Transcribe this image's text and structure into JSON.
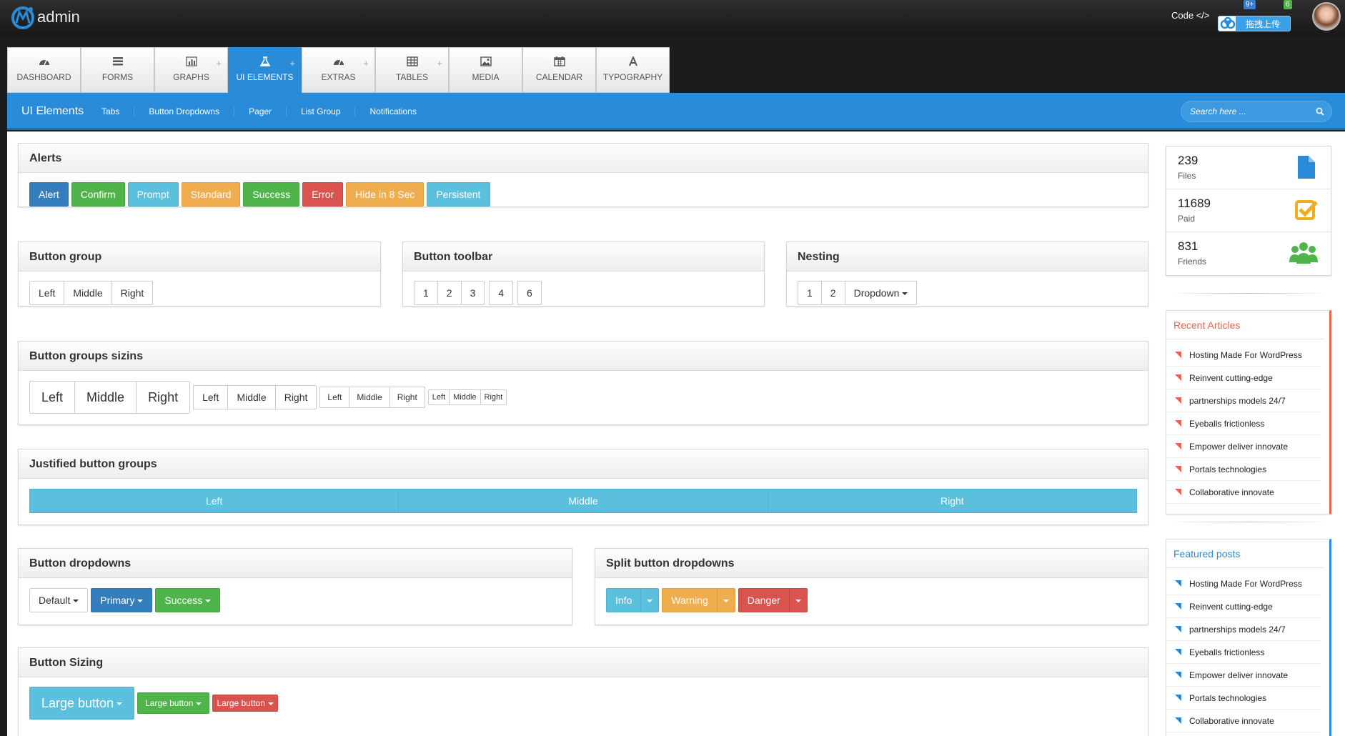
{
  "topbar": {
    "brand": "admin",
    "code_label": "Code </>",
    "badge_messages": "9+",
    "badge_alerts": "6",
    "upload_label": "拖拽上传"
  },
  "tabs": [
    {
      "label": "DASHBOARD",
      "icon": "dashboard-icon",
      "plus": ""
    },
    {
      "label": "FORMS",
      "icon": "list-icon",
      "plus": ""
    },
    {
      "label": "GRAPHS",
      "icon": "bar-chart-icon",
      "plus": "+"
    },
    {
      "label": "UI ELEMENTS",
      "icon": "flask-icon",
      "plus": "+",
      "active": true
    },
    {
      "label": "EXTRAS",
      "icon": "dashboard-icon",
      "plus": "+"
    },
    {
      "label": "TABLES",
      "icon": "table-icon",
      "plus": "+"
    },
    {
      "label": "MEDIA",
      "icon": "image-icon",
      "plus": ""
    },
    {
      "label": "CALENDAR",
      "icon": "calendar-icon",
      "plus": ""
    },
    {
      "label": "TYPOGRAPHY",
      "icon": "font-icon",
      "plus": ""
    }
  ],
  "subnav": {
    "title": "UI Elements",
    "links": [
      "Tabs",
      "Button Dropdowns",
      "Pager",
      "List Group",
      "Notifications"
    ],
    "search_placeholder": "Search here ..."
  },
  "alerts": {
    "title": "Alerts",
    "buttons": [
      "Alert",
      "Confirm",
      "Prompt",
      "Standard",
      "Success",
      "Error",
      "Hide in 8 Sec",
      "Persistent"
    ]
  },
  "button_group": {
    "title": "Button group",
    "buttons": [
      "Left",
      "Middle",
      "Right"
    ]
  },
  "button_toolbar": {
    "title": "Button toolbar",
    "groups": [
      [
        "1",
        "2",
        "3"
      ],
      [
        "4"
      ],
      [
        "6"
      ]
    ]
  },
  "nesting": {
    "title": "Nesting",
    "buttons": [
      "1",
      "2"
    ],
    "dropdown": "Dropdown"
  },
  "sizing_groups": {
    "title": "Button groups sizins",
    "buttons": [
      "Left",
      "Middle",
      "Right"
    ]
  },
  "justified": {
    "title": "Justified button groups",
    "buttons": [
      "Left",
      "Middle",
      "Right"
    ]
  },
  "dropdowns": {
    "title": "Button dropdowns",
    "buttons": [
      "Default",
      "Primary",
      "Success"
    ]
  },
  "split": {
    "title": "Split button dropdowns",
    "buttons": [
      "Info",
      "Warning",
      "Danger"
    ]
  },
  "sizing": {
    "title": "Button Sizing",
    "buttons": [
      "Large button",
      "Large button",
      "Large button"
    ]
  },
  "stats": [
    {
      "number": "239",
      "label": "Files",
      "icon": "file-icon",
      "color": "#2a8bd9"
    },
    {
      "number": "11689",
      "label": "Paid",
      "icon": "checkbox-icon",
      "color": "#f0ad1e"
    },
    {
      "number": "831",
      "label": "Friends",
      "icon": "users-icon",
      "color": "#4fb449"
    }
  ],
  "recent": {
    "title": "Recent Articles",
    "color": "#e8674f",
    "items": [
      "Hosting Made For WordPress",
      "Reinvent cutting-edge",
      "partnerships models 24/7",
      "Eyeballs frictionless",
      "Empower deliver innovate",
      "Portals technologies",
      "Collaborative innovate"
    ]
  },
  "featured": {
    "title": "Featured posts",
    "color": "#2a8bd9",
    "items": [
      "Hosting Made For WordPress",
      "Reinvent cutting-edge",
      "partnerships models 24/7",
      "Eyeballs frictionless",
      "Empower deliver innovate",
      "Portals technologies",
      "Collaborative innovate"
    ]
  }
}
